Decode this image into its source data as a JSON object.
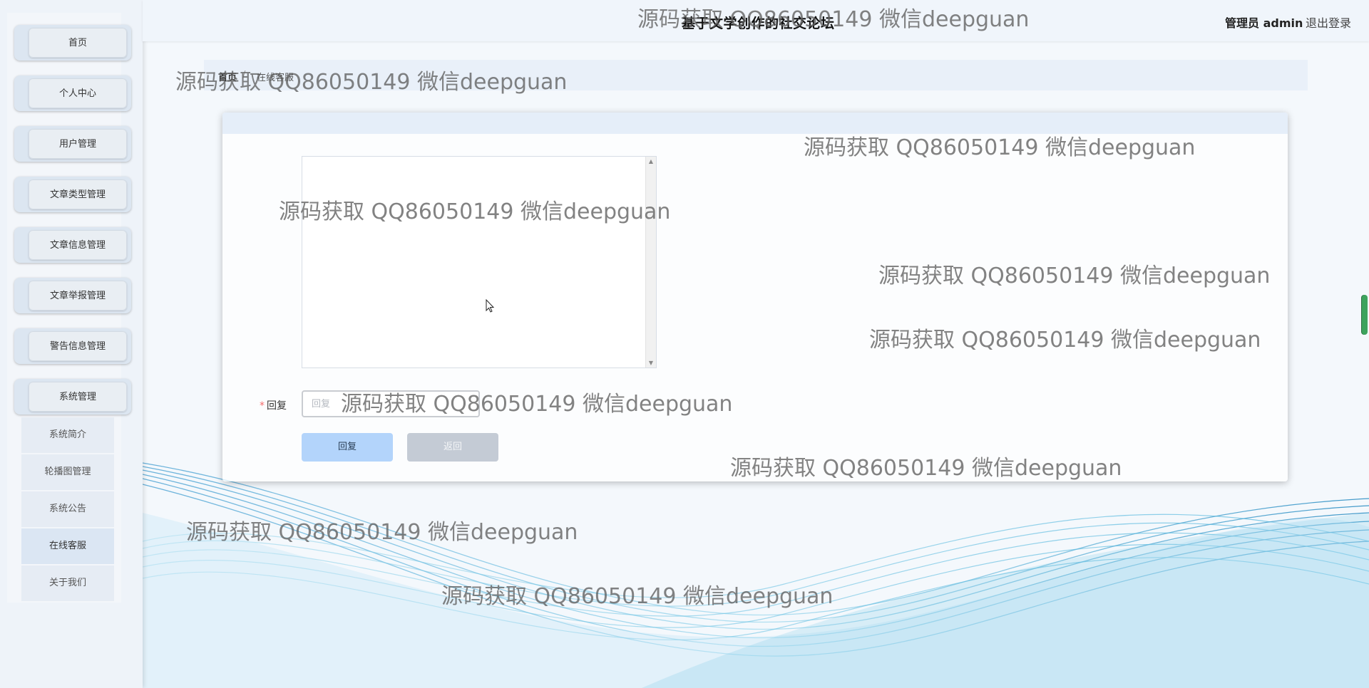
{
  "header": {
    "site_title": "基于文学创作的社交论坛",
    "user_label": "管理员 admin",
    "logout_label": "退出登录"
  },
  "sidebar": {
    "items": [
      {
        "label": "首页"
      },
      {
        "label": "个人中心"
      },
      {
        "label": "用户管理"
      },
      {
        "label": "文章类型管理"
      },
      {
        "label": "文章信息管理"
      },
      {
        "label": "文章举报管理"
      },
      {
        "label": "警告信息管理"
      },
      {
        "label": "系统管理"
      }
    ],
    "sub_items": [
      {
        "label": "系统简介"
      },
      {
        "label": "轮播图管理"
      },
      {
        "label": "系统公告"
      },
      {
        "label": "在线客服",
        "active": true
      },
      {
        "label": "关于我们"
      }
    ]
  },
  "breadcrumb": {
    "home": "首页",
    "separator": "/",
    "current": "在线客服"
  },
  "form": {
    "reply_label": "回复",
    "required_mark": "*",
    "reply_placeholder": "回复",
    "reply_button": "回复",
    "back_button": "返回"
  },
  "watermark": "源码获取 QQ86050149 微信deepguan",
  "colors": {
    "primary_button": "#b3d4fb",
    "secondary_button": "#c4cbd5",
    "required": "#f56c6c",
    "scroll_indicator": "#3da35d"
  }
}
